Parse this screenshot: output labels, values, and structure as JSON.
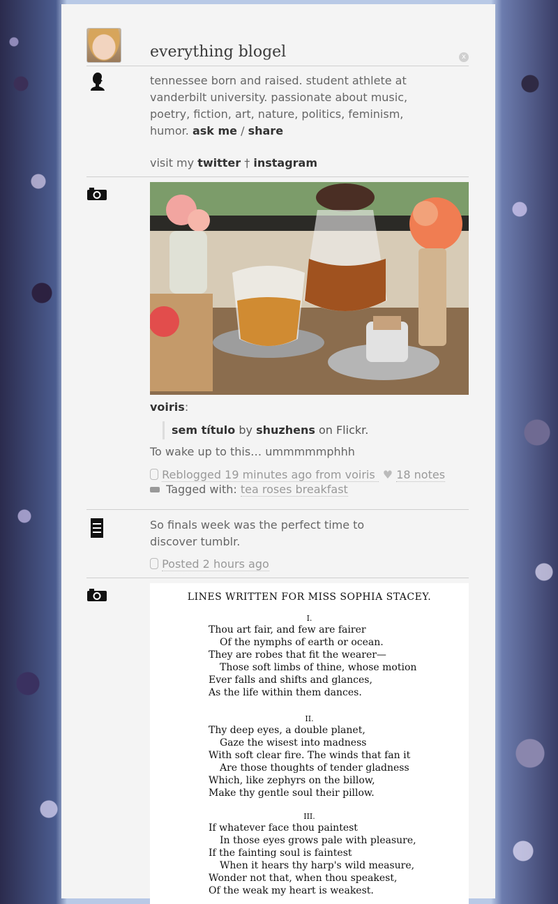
{
  "blog": {
    "title": "everything blogel",
    "close_label": "x",
    "bio_text": "tennessee born and raised. student athlete at vanderbilt university. passionate about music, poetry, fiction, art, nature, politics, feminism, humor.",
    "ask_label": "ask me",
    "separator": "/",
    "share_label": "share",
    "visit_prefix": "visit my",
    "twitter_label": "twitter",
    "dagger": "†",
    "instagram_label": "instagram"
  },
  "posts": [
    {
      "type": "photo",
      "source_user": "voiris",
      "source_colon": ":",
      "quote_title": "sem título",
      "quote_by": "by",
      "quote_author": "shuzhens",
      "quote_on": "on Flickr.",
      "caption": "To wake up to this… ummmmmphhh",
      "reblogged_label": "Reblogged",
      "time": "19 minutes ago",
      "from_label": "from",
      "from_user": "voiris",
      "notes": "18 notes",
      "tagged_label": "Tagged with:",
      "tags": "tea roses breakfast"
    },
    {
      "type": "text",
      "body": "So finals week was the perfect time to discover tumblr.",
      "posted_label": "Posted",
      "time": "2 hours ago"
    },
    {
      "type": "photo",
      "poem": {
        "title": "LINES WRITTEN FOR MISS SOPHIA STACEY.",
        "stanzas": [
          {
            "numeral": "I.",
            "lines": [
              "Thou art fair, and few are fairer",
              "Of the nymphs of earth or ocean.",
              "They are robes that fit the wearer—",
              "Those soft limbs of thine, whose motion",
              "Ever falls and shifts and glances,",
              "As the life within them dances."
            ]
          },
          {
            "numeral": "II.",
            "lines": [
              "Thy deep eyes, a double planet,",
              "Gaze the wisest into madness",
              "With soft clear fire.   The winds that fan it",
              "Are those thoughts of tender gladness",
              "Which, like zephyrs on the billow,",
              "Make thy gentle soul their pillow."
            ]
          },
          {
            "numeral": "III.",
            "lines": [
              "If whatever face thou paintest",
              "In those eyes grows pale with pleasure,",
              "If the fainting soul is faintest",
              "When it hears thy harp's wild measure,",
              "Wonder not that, when thou speakest,",
              "Of the weak my heart is weakest."
            ]
          }
        ]
      }
    }
  ]
}
